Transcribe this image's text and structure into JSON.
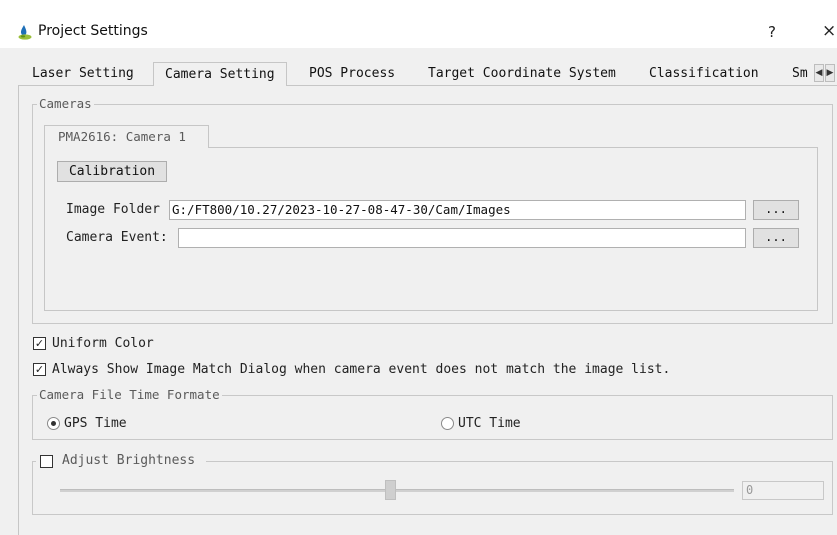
{
  "window": {
    "title": "Project Settings",
    "help_label": "?",
    "close_label": "×"
  },
  "tabs": [
    {
      "label": "Laser Setting"
    },
    {
      "label": "Camera Setting",
      "active": true
    },
    {
      "label": "POS Process"
    },
    {
      "label": "Target Coordinate System"
    },
    {
      "label": "Classification"
    },
    {
      "label": "Sm"
    }
  ],
  "tab_scroll": {
    "left": "◀",
    "right": "▶"
  },
  "cameras": {
    "group_title": "Cameras",
    "camera_tab": "PMA2616: Camera 1",
    "calibration_label": "Calibration",
    "image_folder": {
      "label": "Image Folder",
      "value": "G:/FT800/10.27/2023-10-27-08-47-30/Cam/Images",
      "browse": "..."
    },
    "camera_event": {
      "label": "Camera Event:",
      "value": "",
      "browse": "..."
    }
  },
  "options": {
    "uniform_color": {
      "label": "Uniform Color",
      "checked": true
    },
    "always_show": {
      "label": "Always Show Image Match Dialog when camera event does not match the image list.",
      "checked": true
    },
    "check_mark": "✓"
  },
  "time_format": {
    "group_title": "Camera File Time Formate",
    "gps": {
      "label": "GPS Time",
      "selected": true
    },
    "utc": {
      "label": "UTC Time",
      "selected": false
    }
  },
  "brightness": {
    "label": "Adjust Brightness",
    "checked": false,
    "slider_fraction": 0.49,
    "value": "0"
  }
}
